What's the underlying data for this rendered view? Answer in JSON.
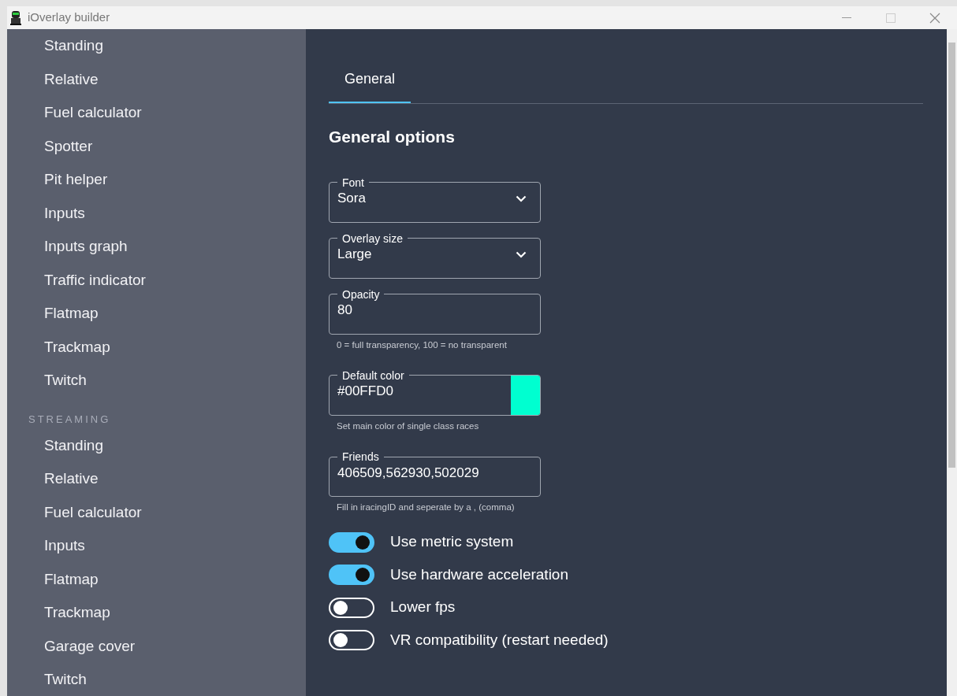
{
  "window": {
    "title": "iOverlay builder"
  },
  "sidebar": {
    "groups": [
      {
        "items": [
          {
            "label": "Standing"
          },
          {
            "label": "Relative"
          },
          {
            "label": "Fuel calculator"
          },
          {
            "label": "Spotter"
          },
          {
            "label": "Pit helper"
          },
          {
            "label": "Inputs"
          },
          {
            "label": "Inputs graph"
          },
          {
            "label": "Traffic indicator"
          },
          {
            "label": "Flatmap"
          },
          {
            "label": "Trackmap"
          },
          {
            "label": "Twitch"
          }
        ]
      },
      {
        "title": "STREAMING",
        "items": [
          {
            "label": "Standing"
          },
          {
            "label": "Relative"
          },
          {
            "label": "Fuel calculator"
          },
          {
            "label": "Inputs"
          },
          {
            "label": "Flatmap"
          },
          {
            "label": "Trackmap"
          },
          {
            "label": "Garage cover"
          },
          {
            "label": "Twitch"
          }
        ]
      }
    ]
  },
  "tabs": [
    {
      "label": "General",
      "selected": true
    }
  ],
  "heading": "General options",
  "fields": [
    {
      "kind": "select",
      "label": "Font",
      "value": "Sora"
    },
    {
      "kind": "select",
      "label": "Overlay size",
      "value": "Large"
    },
    {
      "kind": "text",
      "label": "Opacity",
      "value": "80",
      "help": "0 = full transparency, 100 = no transparent"
    },
    {
      "kind": "color",
      "label": "Default color",
      "value": "#00FFD0",
      "color": "#00ffd0",
      "help": "Set main color of single class races"
    },
    {
      "kind": "text",
      "label": "Friends",
      "value": "406509,562930,502029",
      "help": "Fill in iracingID and seperate by a , (comma)"
    }
  ],
  "switches": [
    {
      "label": "Use metric system",
      "on": true
    },
    {
      "label": "Use hardware acceleration",
      "on": true
    },
    {
      "label": "Lower fps",
      "on": false
    },
    {
      "label": "VR compatibility (restart needed)",
      "on": false
    }
  ]
}
